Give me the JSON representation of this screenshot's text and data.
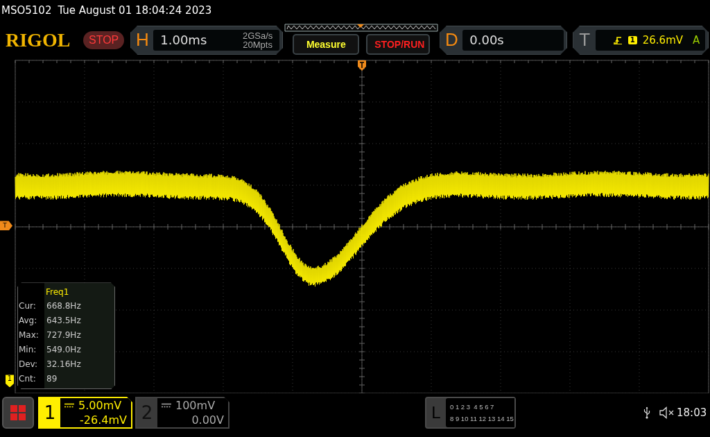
{
  "status_line": {
    "model": "MSO5102",
    "datetime": "Tue August 01 18:04:24 2023"
  },
  "header": {
    "logo": "RIGOL",
    "run_state": "STOP",
    "horizontal": {
      "label": "H",
      "timebase": "1.00ms",
      "sample_rate": "2GSa/s",
      "memory_depth": "20Mpts"
    },
    "buttons": [
      "Measure",
      "STOP/RUN"
    ],
    "delay": {
      "label": "D",
      "value": "0.00s"
    },
    "trigger": {
      "label": "T",
      "source": "1",
      "level": "26.6mV",
      "mode": "A"
    }
  },
  "screen": {
    "trigger_level_marker": "T",
    "channel_marker": "1",
    "measurement": {
      "title": "Freq1",
      "rows": [
        {
          "label": "Cur:",
          "value": "668.8Hz"
        },
        {
          "label": "Avg:",
          "value": "643.5Hz"
        },
        {
          "label": "Max:",
          "value": "727.9Hz"
        },
        {
          "label": "Min:",
          "value": "549.0Hz"
        },
        {
          "label": "Dev:",
          "value": "32.16Hz"
        },
        {
          "label": "Cnt:",
          "value": "89"
        }
      ]
    }
  },
  "bottom_bar": {
    "channels": [
      {
        "number": "1",
        "scale": "5.00mV",
        "offset": "-26.4mV",
        "selected": true
      },
      {
        "number": "2",
        "scale": "100mV",
        "offset": "0.00V",
        "selected": false
      }
    ],
    "logic": {
      "label": "L",
      "row_1": "0 1 2 3  4 5 6 7",
      "row_2": "8 9 10 11 12 13 14 15"
    },
    "clock": "18:03"
  }
}
